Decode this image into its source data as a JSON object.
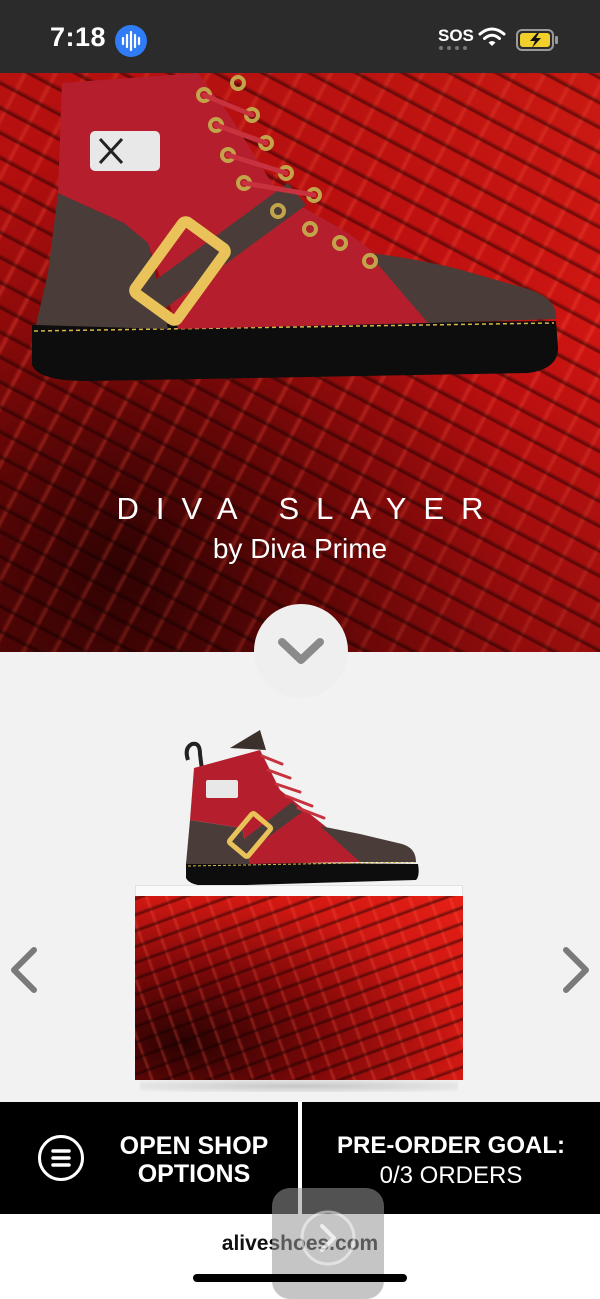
{
  "status_bar": {
    "time": "7:18",
    "sos": "SOS",
    "icons": [
      "voice-memo-icon",
      "wifi-icon",
      "battery-charging-icon"
    ]
  },
  "hero": {
    "title": "DIVA SLAYER",
    "subtitle": "by Diva Prime"
  },
  "bottom_bar": {
    "shop_options_line1": "OPEN SHOP",
    "shop_options_line2": "OPTIONS",
    "goal_title": "PRE-ORDER GOAL:",
    "goal_value": "0/3 ORDERS"
  },
  "footer": {
    "site": "aliveshoes.com"
  },
  "colors": {
    "accent_red": "#c21010",
    "shoe_red": "#b81c2c",
    "shoe_brown": "#4a3a36",
    "buckle_gold": "#e9c35a",
    "bar_black": "#000000"
  }
}
